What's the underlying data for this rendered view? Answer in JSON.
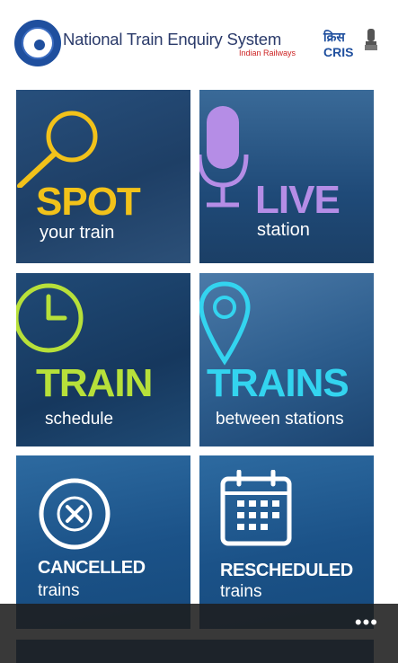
{
  "header": {
    "title": "National Train Enquiry System",
    "subtitle": "Indian Railways",
    "cris_hindi": "क्रिस",
    "cris_label": "CRIS"
  },
  "tiles": [
    {
      "big": "SPOT",
      "small": "your train",
      "icon": "magnifier-icon",
      "accent": "#f2c21a"
    },
    {
      "big": "LIVE",
      "small": "station",
      "icon": "microphone-icon",
      "accent": "#b58de6"
    },
    {
      "big": "TRAIN",
      "small": "schedule",
      "icon": "clock-icon",
      "accent": "#b7e03a"
    },
    {
      "big": "TRAINS",
      "small": "between stations",
      "icon": "location-pin-icon",
      "accent": "#33d4ef"
    },
    {
      "big": "CANCELLED",
      "small": "trains",
      "icon": "cancel-circle-icon",
      "accent": "#ffffff"
    },
    {
      "big": "RESCHEDULED",
      "small": "trains",
      "icon": "calendar-icon",
      "accent": "#ffffff"
    }
  ],
  "appbar": {
    "more_label": "•••"
  },
  "colors": {
    "header_text": "#2a3a6a",
    "tile_blue": "#1d4f80",
    "appbar": "#1e1e1e"
  }
}
